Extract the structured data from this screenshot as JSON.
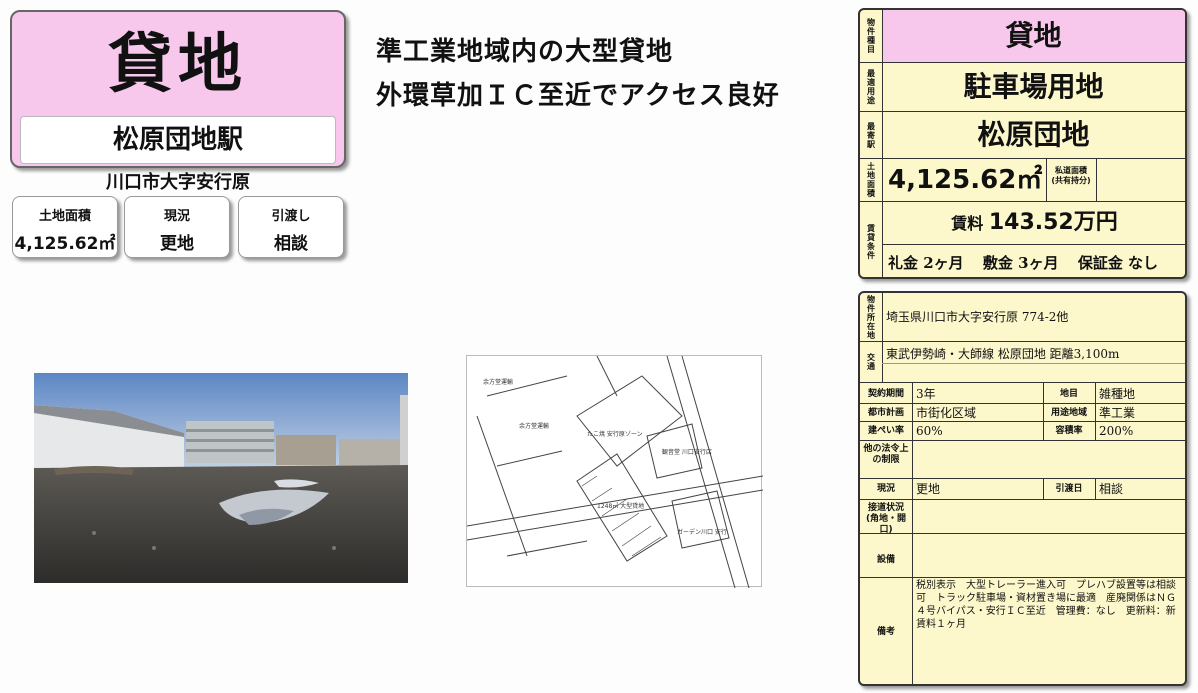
{
  "hero": {
    "title": "貸地",
    "station": "松原団地駅",
    "address": "川口市大字安行原"
  },
  "summary": [
    {
      "label": "土地面積",
      "value": "4,125.62㎡"
    },
    {
      "label": "現況",
      "value": "更地"
    },
    {
      "label": "引渡し",
      "value": "相談"
    }
  ],
  "headline": {
    "line1": "準工業地域内の大型貸地",
    "line2": "外環草加ＩＣ至近でアクセス良好"
  },
  "map": {
    "labels": [
      "余方堂運輸",
      "余方堂運輸",
      "1248㎡ 大型貸地",
      "ガーデン川口 安行",
      "観音堂 川口安行店",
      "たこ焼 安行原ゾーン"
    ]
  },
  "panel1": {
    "labels": {
      "type": "物件種目",
      "use": "最適用途",
      "station": "最寄駅",
      "area": "土地面積",
      "conditions": "賃貸条件"
    },
    "type_value": "貸地",
    "use_value": "駐車場用地",
    "station_value": "松原団地",
    "area_value": "4,125.62㎡",
    "private_road_label": "私道面積",
    "private_road_sub": "(共有持分)",
    "rent_label": "賃料",
    "rent_value": "143.52万円",
    "key_money": "礼金 2ヶ月",
    "deposit": "敷金 3ヶ月",
    "guarantee": "保証金 なし"
  },
  "panel2": {
    "location_label": "物件所在地",
    "location_value": "埼玉県川口市大字安行原 774-2他",
    "transport_label": "交通",
    "transport_value": "東武伊勢崎・大師線 松原団地 距離3,100m",
    "contract_label": "契約期間",
    "contract_value": "3年",
    "land_label": "地目",
    "land_value": "雑種地",
    "city_plan_label": "都市計画",
    "city_plan_value": "市街化区域",
    "zoning_label": "用途地域",
    "zoning_value": "準工業",
    "bcr_label": "建ぺい率",
    "bcr_value": "60%",
    "far_label": "容積率",
    "far_value": "200%",
    "other_law_label": "他の法令上の制限",
    "status_label": "現況",
    "status_value": "更地",
    "handover_label": "引渡日",
    "handover_value": "相談",
    "road_label": "接道状況",
    "road_sub": "(角地・開口)",
    "facility_label": "設備",
    "remarks_label": "備考",
    "remarks_value": "税別表示　大型トレーラー進入可　プレハブ設置等は相談可　トラック駐車場・資材置き場に最適　産廃関係はＮＧ　４号バイパス・安行ＩＣ至近　管理費：なし　更新料：新賃料１ヶ月"
  }
}
